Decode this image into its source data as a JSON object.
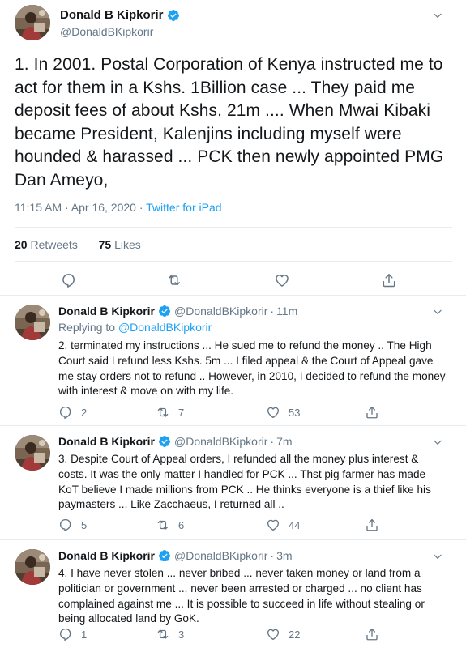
{
  "main_tweet": {
    "author_name": "Donald B Kipkorir",
    "author_handle": "@DonaldBKipkorir",
    "text": "1. In 2001. Postal Corporation of Kenya instructed me to act for them in a Kshs. 1Billion case ... They paid me deposit fees of about Kshs. 21m .... When Mwai Kibaki became President, Kalenjins including myself were hounded & harassed ... PCK then newly appointed PMG Dan Ameyo,",
    "timestamp": "11:15 AM · Apr 16, 2020 · ",
    "source": "Twitter for iPad",
    "retweets_count": "20",
    "retweets_label": " Retweets",
    "likes_count": "75",
    "likes_label": " Likes"
  },
  "replies": [
    {
      "author_name": "Donald B Kipkorir",
      "author_handle": "@DonaldBKipkorir",
      "time_ago": "11m",
      "replying_prefix": "Replying to ",
      "replying_to": "@DonaldBKipkorir",
      "text": "2. terminated my instructions ... He sued me to refund the money .. The High Court said I refund less Kshs. 5m ... I filed appeal & the Court of Appeal gave me stay orders not to refund .. However, in 2010, I decided to refund the money with interest & move on with my life.",
      "reply_count": "2",
      "retweet_count": "7",
      "like_count": "53"
    },
    {
      "author_name": "Donald B Kipkorir",
      "author_handle": "@DonaldBKipkorir",
      "time_ago": "7m",
      "text": "3. Despite Court of Appeal orders, I refunded all the money plus interest & costs. It was the only matter I handled for PCK ... Thst pig farmer has made KoT believe I made millions from PCK .. He thinks everyone is a thief like his paymasters ... Like Zacchaeus, I returned all ..",
      "reply_count": "5",
      "retweet_count": "6",
      "like_count": "44"
    },
    {
      "author_name": "Donald B Kipkorir",
      "author_handle": "@DonaldBKipkorir",
      "time_ago": "3m",
      "text": "4. I have never stolen ... never bribed ... never taken money or land from a politician or government ... never been arrested or charged ... no client has complained against me ... It is possible to succeed in life without stealing or being allocated land by GoK.",
      "reply_count": "1",
      "retweet_count": "3",
      "like_count": "22"
    }
  ],
  "icons": {
    "verified": "verified-badge-icon",
    "caret": "chevron-down-icon",
    "reply": "reply-icon",
    "retweet": "retweet-icon",
    "like": "heart-icon",
    "share": "share-icon"
  },
  "colors": {
    "accent": "#1da1f2",
    "text": "#14171a",
    "secondary": "#657786",
    "divider": "#e6ecf0"
  }
}
